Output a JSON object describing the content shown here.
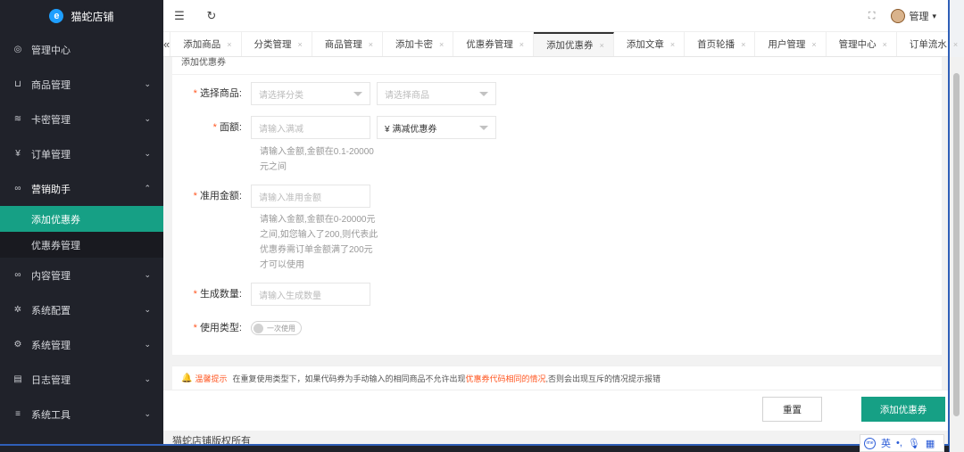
{
  "brand": {
    "name": "猫蛇店铺",
    "logo_letter": "e"
  },
  "sidebar": {
    "items": [
      {
        "label": "管理中心",
        "icon": "dashboard-icon",
        "glyph": "◎",
        "arrow": ""
      },
      {
        "label": "商品管理",
        "icon": "cart-icon",
        "glyph": "⊔",
        "arrow": "⌄"
      },
      {
        "label": "卡密管理",
        "icon": "layers-icon",
        "glyph": "≋",
        "arrow": "⌄"
      },
      {
        "label": "订单管理",
        "icon": "yen-icon",
        "glyph": "¥",
        "arrow": "⌄"
      },
      {
        "label": "营销助手",
        "icon": "link-icon",
        "glyph": "∞",
        "arrow": "⌃",
        "open": true
      }
    ],
    "submenu": [
      {
        "label": "添加优惠券",
        "active": true
      },
      {
        "label": "优惠券管理",
        "active": false
      }
    ],
    "items_after": [
      {
        "label": "内容管理",
        "icon": "link-icon",
        "glyph": "∞",
        "arrow": "⌄"
      },
      {
        "label": "系统配置",
        "icon": "gear-icon",
        "glyph": "✲",
        "arrow": "⌄"
      },
      {
        "label": "系统管理",
        "icon": "settings-icon",
        "glyph": "⚙",
        "arrow": "⌄"
      },
      {
        "label": "日志管理",
        "icon": "document-icon",
        "glyph": "▤",
        "arrow": "⌄"
      },
      {
        "label": "系统工具",
        "icon": "sliders-icon",
        "glyph": "≡",
        "arrow": "⌄"
      }
    ]
  },
  "header": {
    "menu_toggle_glyph": "☰",
    "refresh_glyph": "↻",
    "fullscreen_glyph": "⛶",
    "admin_label": "管理",
    "admin_caret": "▾"
  },
  "tabs": {
    "prev_glyph": "«",
    "next_glyph": "»",
    "more_glyph": "⌄",
    "close_glyph": "×",
    "items": [
      {
        "label": "添加商品",
        "active": false
      },
      {
        "label": "分类管理",
        "active": false
      },
      {
        "label": "商品管理",
        "active": false
      },
      {
        "label": "添加卡密",
        "active": false
      },
      {
        "label": "优惠券管理",
        "active": false
      },
      {
        "label": "添加优惠券",
        "active": true
      },
      {
        "label": "添加文章",
        "active": false
      },
      {
        "label": "首页轮播",
        "active": false
      },
      {
        "label": "用户管理",
        "active": false
      },
      {
        "label": "管理中心",
        "active": false
      },
      {
        "label": "订单流水",
        "active": false
      }
    ]
  },
  "form": {
    "title": "添加优惠券",
    "required_mark": "*",
    "product_label": "选择商品:",
    "category_placeholder": "请选择分类",
    "product_placeholder": "请选择商品",
    "amount_label": "面额:",
    "amount_placeholder": "请输入满减",
    "coupon_type_value": "¥ 满减优惠券",
    "amount_hint": "请输入金额,金额在0.1-20000元之间",
    "min_label": "准用金额:",
    "min_placeholder": "请输入准用金额",
    "min_hint": "请输入金额,金额在0-20000元之间,如您输入了200,则代表此优惠券需订单金额满了200元才可以使用",
    "count_label": "生成数量:",
    "count_placeholder": "请输入生成数量",
    "usage_label": "使用类型:",
    "usage_switch_text": "一次使用"
  },
  "notice": {
    "bell_glyph": "🔔",
    "tip": "温馨提示",
    "text_before": "在重复使用类型下，如果代码券为手动输入的相同商品不允许出现",
    "highlight": "优惠券代码相同的情况",
    "text_after": ",否则会出现互斥的情况提示报错"
  },
  "actions": {
    "reset_label": "重置",
    "submit_label": "添加优惠券"
  },
  "footer": {
    "copyright": "猫蛇店铺版权所有"
  },
  "ime": {
    "lang": "英",
    "icons": [
      "dot-icon",
      "mic-icon",
      "grid-icon"
    ]
  },
  "colors": {
    "sidebar_bg": "#20222a",
    "accent": "#16a085",
    "required": "#ff5722"
  }
}
